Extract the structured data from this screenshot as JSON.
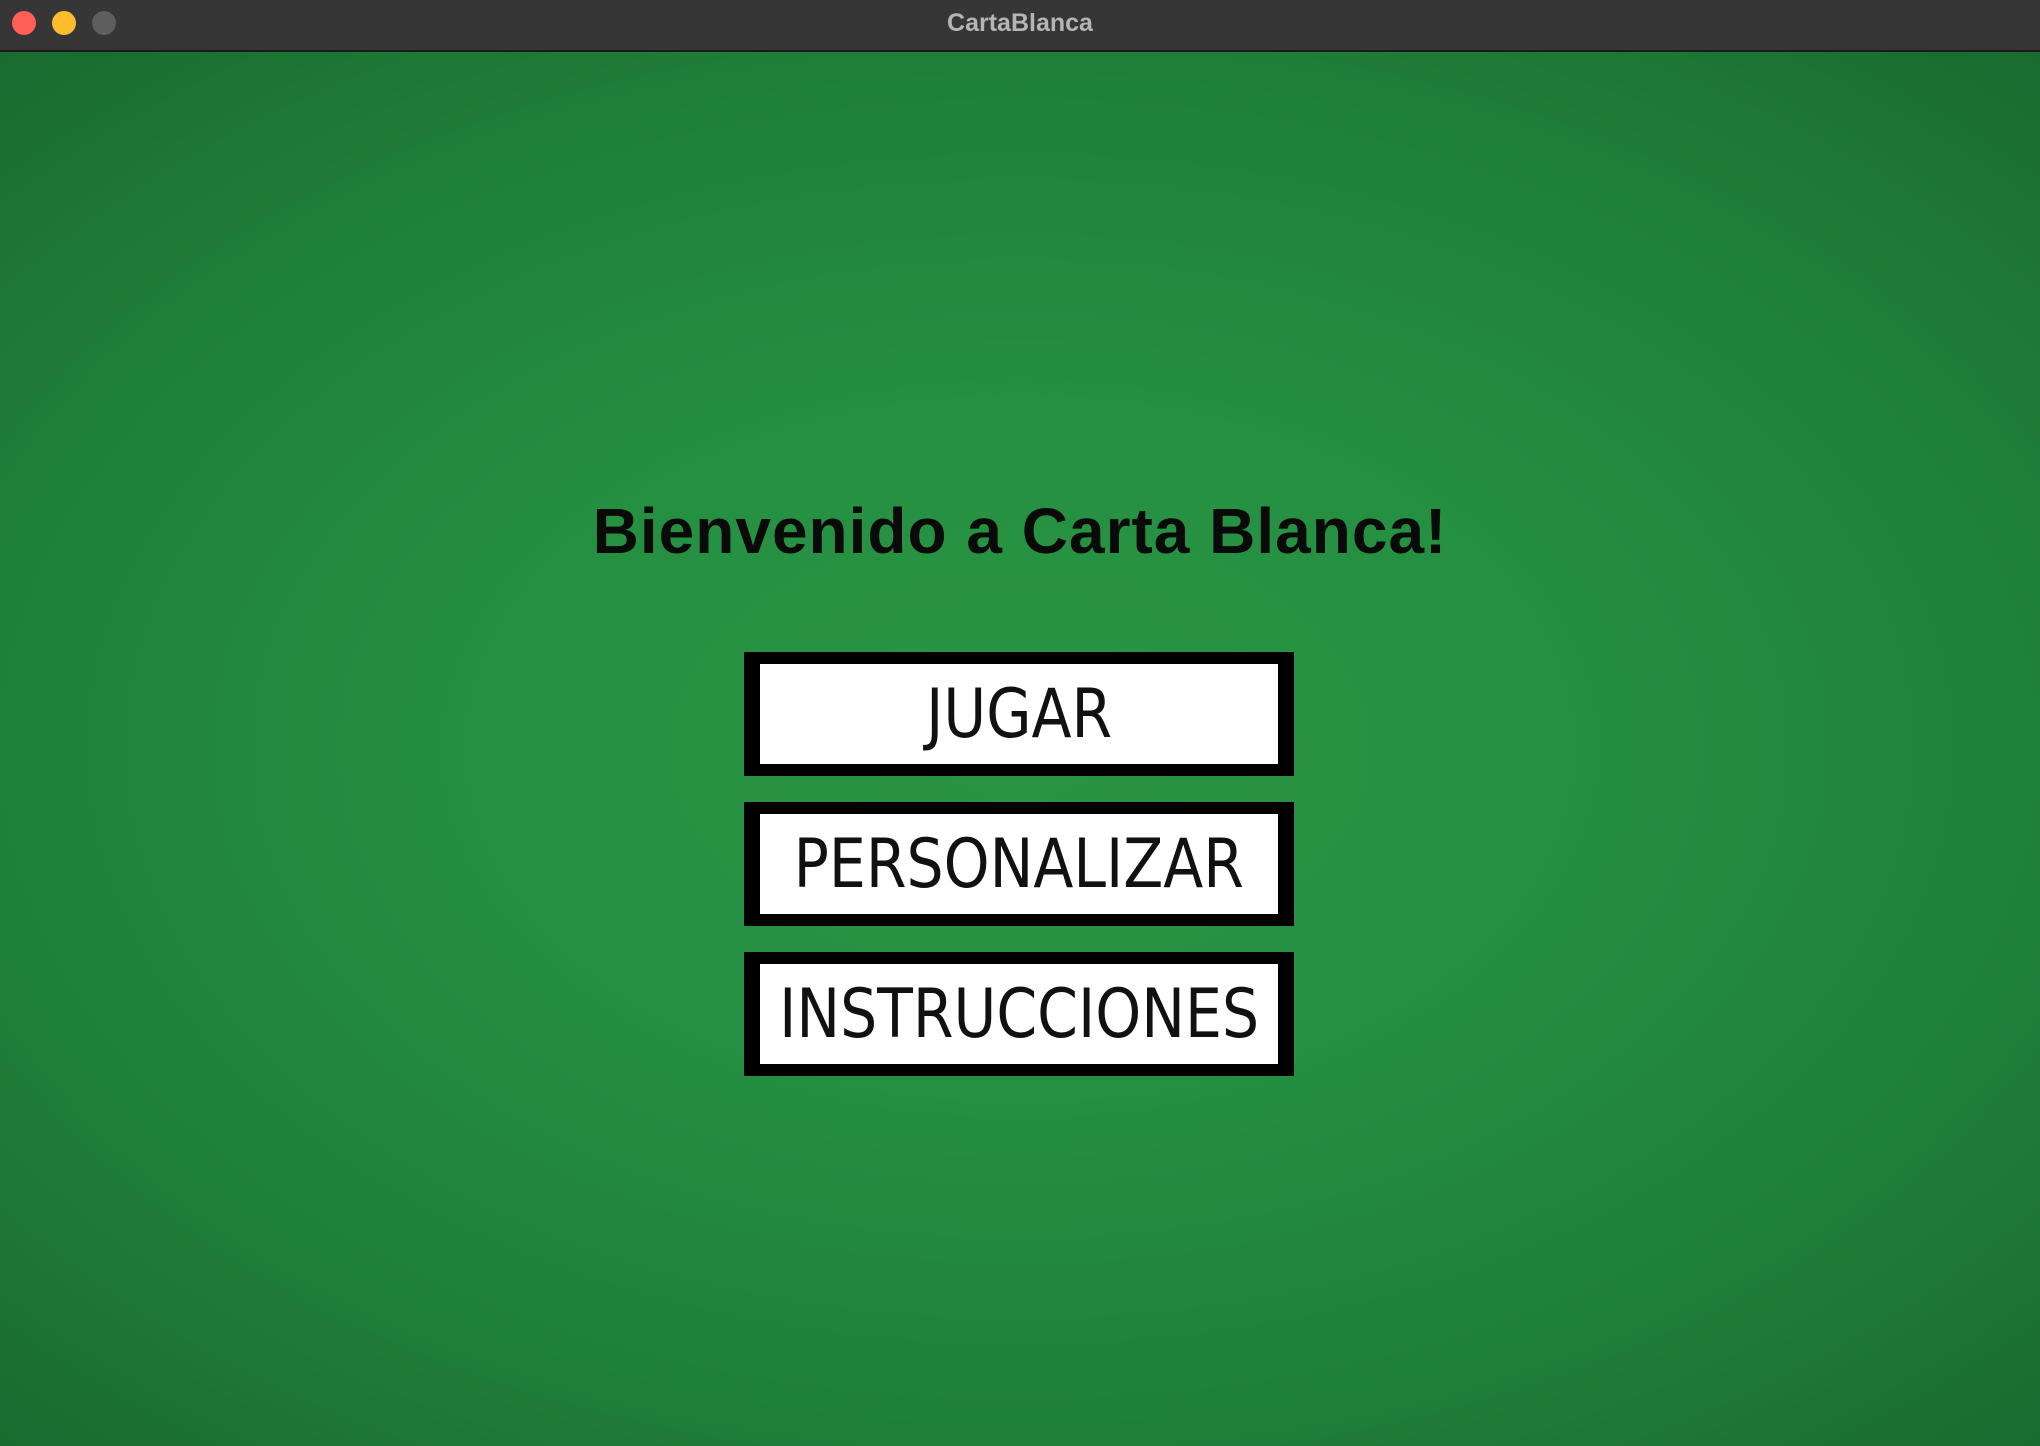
{
  "window": {
    "title": "CartaBlanca",
    "controls": {
      "close_color": "#ff5f57",
      "minimize_color": "#febc2e",
      "zoom_color": "#5e5e5e"
    }
  },
  "main": {
    "background_color": "#259041",
    "welcome_text": "Bienvenido a Carta Blanca!",
    "buttons": [
      {
        "label": "JUGAR"
      },
      {
        "label": "PERSONALIZAR"
      },
      {
        "label": "INSTRUCCIONES"
      }
    ]
  }
}
